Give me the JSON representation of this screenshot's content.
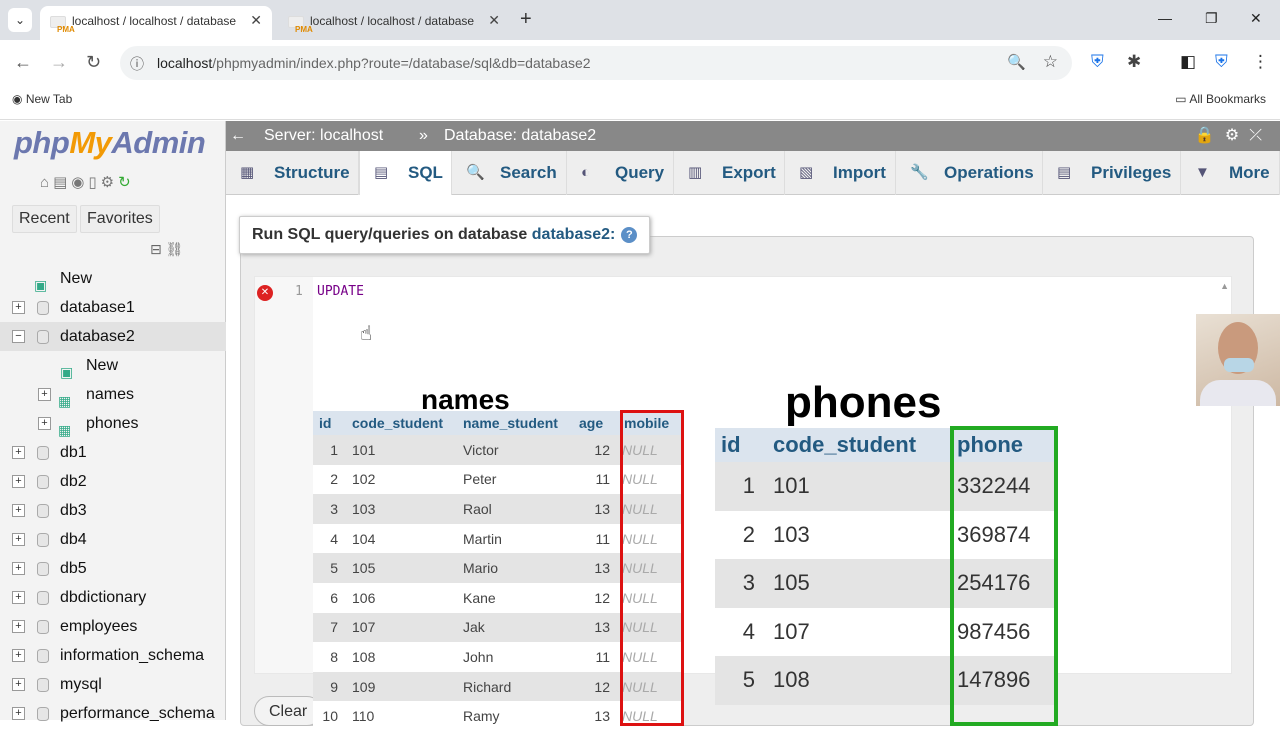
{
  "browser": {
    "tabs": [
      {
        "favicon": "PMA",
        "title": "localhost / localhost / database"
      },
      {
        "favicon": "PMA",
        "title": "localhost / localhost / database"
      }
    ],
    "url_host": "localhost",
    "url_path": "/phpmyadmin/index.php?route=/database/sql&db=database2",
    "bookmarks": {
      "new_tab": "New Tab",
      "all": "All Bookmarks"
    }
  },
  "pma": {
    "logo": {
      "php": "php",
      "my": "My",
      "admin": "Admin"
    },
    "recent": "Recent",
    "favorites": "Favorites",
    "tree": [
      {
        "label": "New",
        "level": 0,
        "kind": "new"
      },
      {
        "label": "database1",
        "level": 0,
        "kind": "db"
      },
      {
        "label": "database2",
        "level": 0,
        "kind": "db",
        "selected": true
      },
      {
        "label": "New",
        "level": 1,
        "kind": "new"
      },
      {
        "label": "names",
        "level": 1,
        "kind": "table"
      },
      {
        "label": "phones",
        "level": 1,
        "kind": "table"
      },
      {
        "label": "db1",
        "level": 0,
        "kind": "db"
      },
      {
        "label": "db2",
        "level": 0,
        "kind": "db"
      },
      {
        "label": "db3",
        "level": 0,
        "kind": "db"
      },
      {
        "label": "db4",
        "level": 0,
        "kind": "db"
      },
      {
        "label": "db5",
        "level": 0,
        "kind": "db"
      },
      {
        "label": "dbdictionary",
        "level": 0,
        "kind": "db"
      },
      {
        "label": "employees",
        "level": 0,
        "kind": "db"
      },
      {
        "label": "information_schema",
        "level": 0,
        "kind": "db"
      },
      {
        "label": "mysql",
        "level": 0,
        "kind": "db"
      },
      {
        "label": "performance_schema",
        "level": 0,
        "kind": "db"
      }
    ],
    "breadcrumb": {
      "server": "Server: localhost",
      "sep": "»",
      "database": "Database: database2"
    },
    "menu": [
      "Structure",
      "SQL",
      "Search",
      "Query",
      "Export",
      "Import",
      "Operations",
      "Privileges",
      "More"
    ],
    "active_tab": "SQL",
    "legend": {
      "prefix": "Run SQL query/queries on database ",
      "db": "database2:"
    },
    "editor": {
      "line": "1",
      "code": "UPDATE"
    },
    "clear": "Clear"
  },
  "overlay": {
    "names": {
      "title": "names",
      "columns": [
        "id",
        "code_student",
        "name_student",
        "age",
        "mobile"
      ],
      "rows": [
        [
          "1",
          "101",
          "Victor",
          "12",
          "NULL"
        ],
        [
          "2",
          "102",
          "Peter",
          "11",
          "NULL"
        ],
        [
          "3",
          "103",
          "Raol",
          "13",
          "NULL"
        ],
        [
          "4",
          "104",
          "Martin",
          "11",
          "NULL"
        ],
        [
          "5",
          "105",
          "Mario",
          "13",
          "NULL"
        ],
        [
          "6",
          "106",
          "Kane",
          "12",
          "NULL"
        ],
        [
          "7",
          "107",
          "Jak",
          "13",
          "NULL"
        ],
        [
          "8",
          "108",
          "John",
          "11",
          "NULL"
        ],
        [
          "9",
          "109",
          "Richard",
          "12",
          "NULL"
        ],
        [
          "10",
          "110",
          "Ramy",
          "13",
          "NULL"
        ]
      ]
    },
    "phones": {
      "title": "phones",
      "columns": [
        "id",
        "code_student",
        "phone"
      ],
      "rows": [
        [
          "1",
          "101",
          "332244"
        ],
        [
          "2",
          "103",
          "369874"
        ],
        [
          "3",
          "105",
          "254176"
        ],
        [
          "4",
          "107",
          "987456"
        ],
        [
          "5",
          "108",
          "147896"
        ]
      ]
    }
  },
  "colors": {
    "highlight_red": "#d11111",
    "highlight_green": "#22aa22",
    "link_blue": "#235a81"
  }
}
